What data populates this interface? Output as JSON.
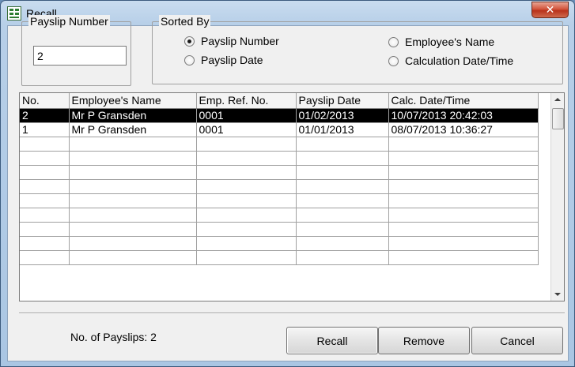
{
  "window": {
    "title": "Recall",
    "close_symbol": "✕"
  },
  "payslip_number_group": {
    "label": "Payslip Number",
    "value": "2"
  },
  "sorted_by_group": {
    "label": "Sorted By",
    "options": [
      {
        "label": "Payslip Number",
        "checked": true
      },
      {
        "label": "Payslip Date",
        "checked": false
      },
      {
        "label": "Employee's Name",
        "checked": false
      },
      {
        "label": "Calculation Date/Time",
        "checked": false
      }
    ]
  },
  "table": {
    "columns": [
      "No.",
      "Employee's Name",
      "Emp. Ref. No.",
      "Payslip Date",
      "Calc. Date/Time"
    ],
    "rows": [
      {
        "no": "2",
        "name": "Mr P Gransden",
        "ref": "0001",
        "date": "01/02/2013",
        "calc": "10/07/2013 20:42:03",
        "selected": true
      },
      {
        "no": "1",
        "name": "Mr P Gransden",
        "ref": "0001",
        "date": "01/01/2013",
        "calc": "08/07/2013 10:36:27",
        "selected": false
      }
    ],
    "empty_rows": 9
  },
  "footer": {
    "count_label": "No. of Payslips:",
    "count_value": "2",
    "recall_label": "Recall",
    "remove_label": "Remove",
    "cancel_label": "Cancel"
  }
}
